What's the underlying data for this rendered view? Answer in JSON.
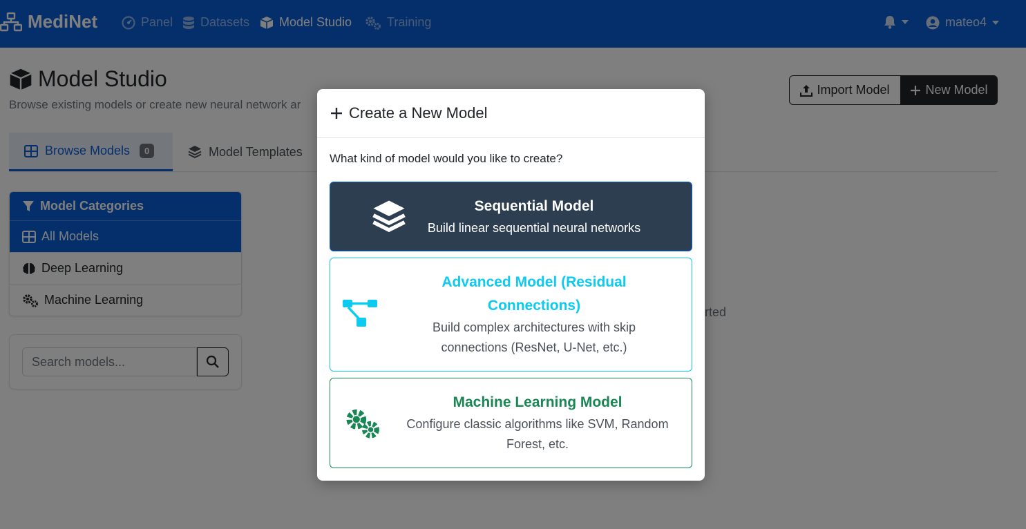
{
  "navbar": {
    "brand": "MediNet",
    "links": [
      {
        "label": "Panel",
        "icon": "dashboard-icon"
      },
      {
        "label": "Datasets",
        "icon": "database-icon"
      },
      {
        "label": "Model Studio",
        "icon": "cube-icon"
      },
      {
        "label": "Training",
        "icon": "cogs-icon"
      }
    ],
    "user": "mateo4",
    "bg_color": "#0b5ed7"
  },
  "page": {
    "title": "Model Studio",
    "subtitle": "Browse existing models or create new neural network ar",
    "import_label": "Import Model",
    "new_label": "New Model"
  },
  "tabs": [
    {
      "label": "Browse Models",
      "badge": "0"
    },
    {
      "label": "Model Templates"
    }
  ],
  "sidebar": {
    "header": "Model Categories",
    "items": [
      {
        "label": "All Models"
      },
      {
        "label": "Deep Learning"
      },
      {
        "label": "Machine Learning"
      }
    ],
    "search_placeholder": "Search models..."
  },
  "background_fragment": "arted",
  "modal": {
    "title": "Create a New Model",
    "question": "What kind of model would you like to create?",
    "options": [
      {
        "title": "Sequential Model",
        "desc": "Build linear sequential neural networks",
        "icon": "layers-icon",
        "color": "#2c3e50"
      },
      {
        "title_line1": "Advanced Model (Residual",
        "title_line2": "Connections)",
        "desc_line1": "Build complex architectures with skip",
        "desc_line2": "connections (ResNet, U-Net, etc.)",
        "icon": "project-diagram-icon",
        "color": "#0dcaf0"
      },
      {
        "title": "Machine Learning Model",
        "desc_line1": "Configure classic algorithms like SVM, Random",
        "desc_line2": "Forest, etc.",
        "icon": "cogs-icon",
        "color": "#198754"
      }
    ]
  }
}
